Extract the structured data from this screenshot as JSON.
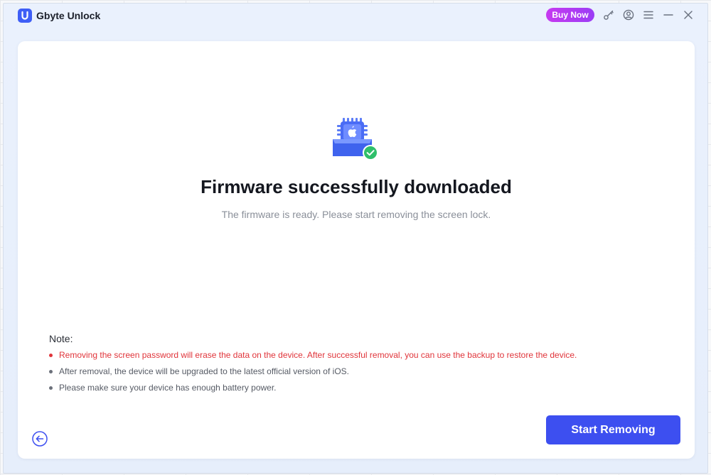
{
  "app": {
    "title": "Gbyte Unlock",
    "logo_letter": "U",
    "accent_color": "#3d4ff0",
    "buy_now_label": "Buy Now"
  },
  "titlebar_icons": [
    "key-icon",
    "account-icon",
    "menu-icon",
    "minimize-icon",
    "close-icon"
  ],
  "main": {
    "illustration": "firmware-chip-check-icon",
    "headline": "Firmware successfully downloaded",
    "subline": "The firmware is ready. Please start removing the screen lock.",
    "note_title": "Note:",
    "notes": [
      "Removing the screen password will erase the data on the device. After successful removal, you can use the backup to restore the device.",
      "After removal, the device will be upgraded to the latest official version of iOS.",
      "Please make sure your device has enough battery power."
    ],
    "warning_color": "#e0343a",
    "start_button_label": "Start Removing"
  }
}
